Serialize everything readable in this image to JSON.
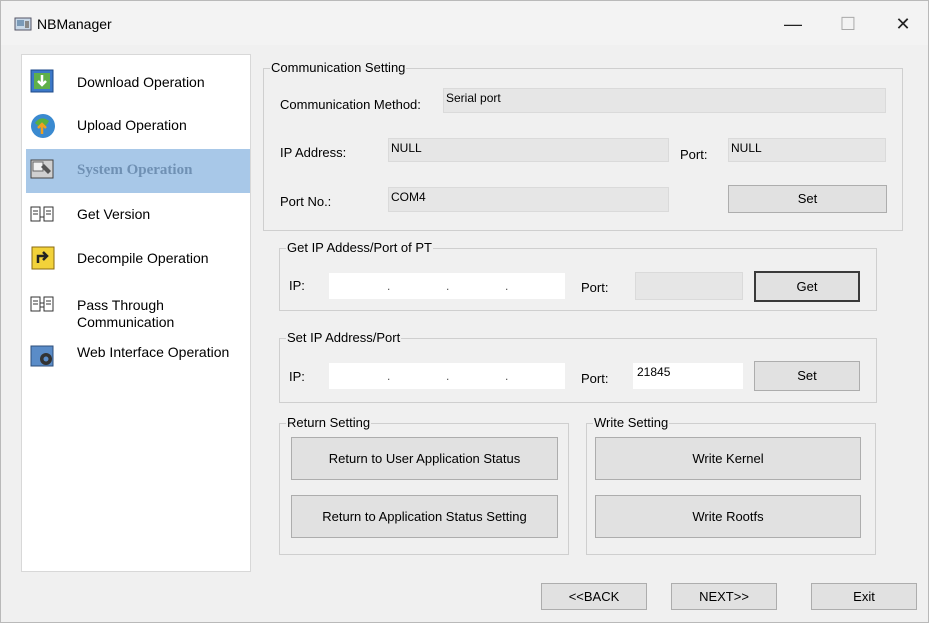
{
  "window": {
    "title": "NBManager",
    "controls": {
      "minimize": "—",
      "maximize": "☐",
      "close": "✕"
    }
  },
  "sidebar": {
    "items": [
      {
        "label": "Download Operation"
      },
      {
        "label": "Upload Operation"
      },
      {
        "label": "System Operation",
        "selected": true
      },
      {
        "label": "Get Version"
      },
      {
        "label": "Decompile Operation"
      },
      {
        "label": "Pass Through Communication"
      },
      {
        "label": "Web Interface Operation"
      }
    ]
  },
  "comm": {
    "legend": "Communication Setting",
    "method_label": "Communication Method:",
    "method_value": "Serial port",
    "ip_label": "IP Address:",
    "ip_value": "NULL",
    "port_label": "Port:",
    "port_value": "NULL",
    "portno_label": "Port No.:",
    "portno_value": "COM4",
    "set_button": "Set"
  },
  "get_ip": {
    "legend": "Get IP Addess/Port of PT",
    "ip_label": "IP:",
    "port_label": "Port:",
    "get_button": "Get"
  },
  "set_ip": {
    "legend": "Set IP Address/Port",
    "ip_label": "IP:",
    "port_label": "Port:",
    "port_value": "21845",
    "set_button": "Set"
  },
  "return_setting": {
    "legend": "Return Setting",
    "user_app_button": "Return to User Application Status",
    "app_status_button": "Return to Application Status Setting"
  },
  "write_setting": {
    "legend": "Write Setting",
    "kernel_button": "Write Kernel",
    "rootfs_button": "Write Rootfs"
  },
  "footer": {
    "back_button": "<<BACK",
    "next_button": "NEXT>>",
    "exit_button": "Exit"
  }
}
